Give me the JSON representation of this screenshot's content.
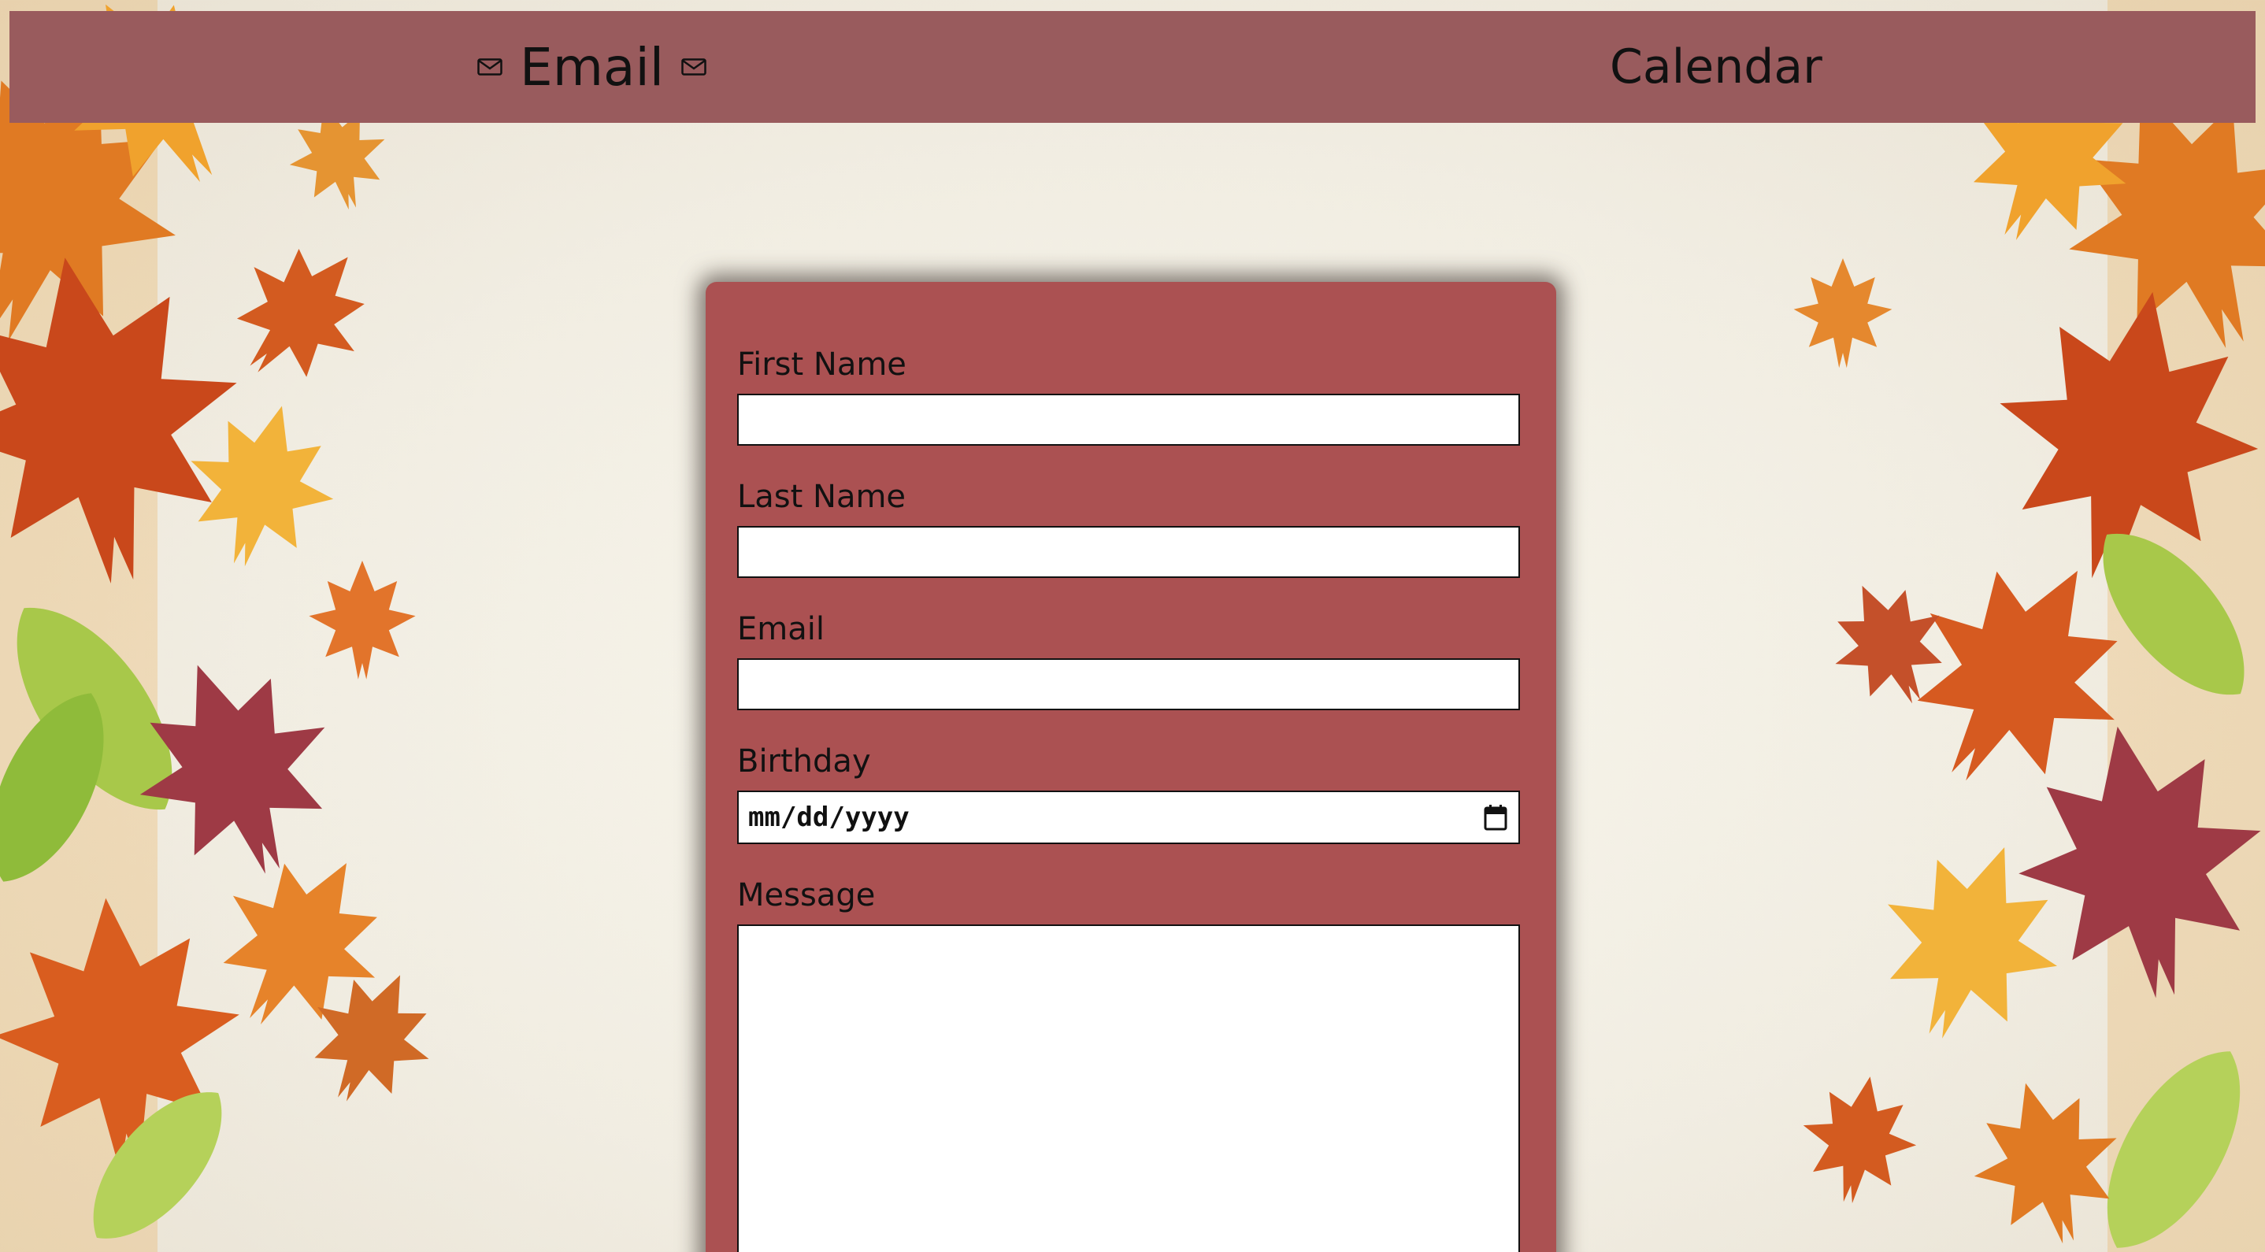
{
  "nav": {
    "email_label": "Email",
    "calendar_label": "Calendar"
  },
  "form": {
    "first_name": {
      "label": "First Name",
      "value": ""
    },
    "last_name": {
      "label": "Last Name",
      "value": ""
    },
    "email": {
      "label": "Email",
      "value": ""
    },
    "birthday": {
      "label": "Birthday",
      "placeholder": "mm/dd/yyyy"
    },
    "message": {
      "label": "Message",
      "value": ""
    }
  },
  "icons": {
    "nav_left": "envelope-icon",
    "nav_right": "envelope-icon",
    "date_picker": "calendar-icon"
  },
  "colors": {
    "navbar": "#995b5d",
    "card": "#ab5152",
    "background": "#f3efe4"
  }
}
